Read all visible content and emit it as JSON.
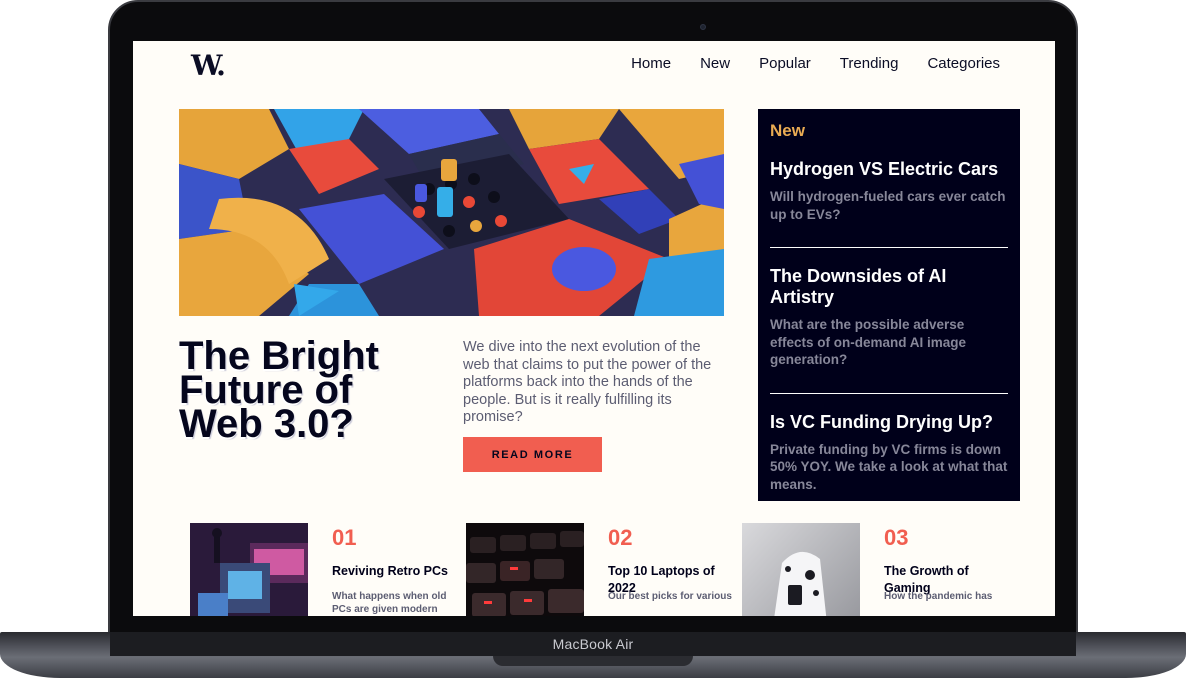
{
  "device": {
    "label": "MacBook Air"
  },
  "site": {
    "logo": "W.",
    "nav": [
      "Home",
      "New",
      "Popular",
      "Trending",
      "Categories"
    ]
  },
  "hero": {
    "title": "The Bright Future of Web 3.0?",
    "description": "We dive into the next evolution of the web that claims to put the power of the platforms back into the hands of the people. But is it really fulfilling its promise?",
    "button_label": "READ MORE"
  },
  "new_panel": {
    "heading": "New",
    "items": [
      {
        "title": "Hydrogen VS Electric Cars",
        "description": "Will hydrogen-fueled cars ever catch up to EVs?"
      },
      {
        "title": "The Downsides of AI Artistry",
        "description": "What are the possible adverse effects of on-demand AI image generation?"
      },
      {
        "title": "Is VC Funding Drying Up?",
        "description": "Private funding by VC firms is down 50% YOY. We take a look at what that means."
      }
    ]
  },
  "cards": [
    {
      "number": "01",
      "title": "Reviving Retro PCs",
      "description": "What happens when old PCs are given modern"
    },
    {
      "number": "02",
      "title": "Top 10 Laptops of 2022",
      "description": "Our best picks for various"
    },
    {
      "number": "03",
      "title": "The Growth of Gaming",
      "description": "How the pandemic has"
    }
  ],
  "colors": {
    "accent": "#f15e50",
    "navy": "#00001a",
    "highlight": "#e9ab53",
    "background": "#fffdf8"
  }
}
